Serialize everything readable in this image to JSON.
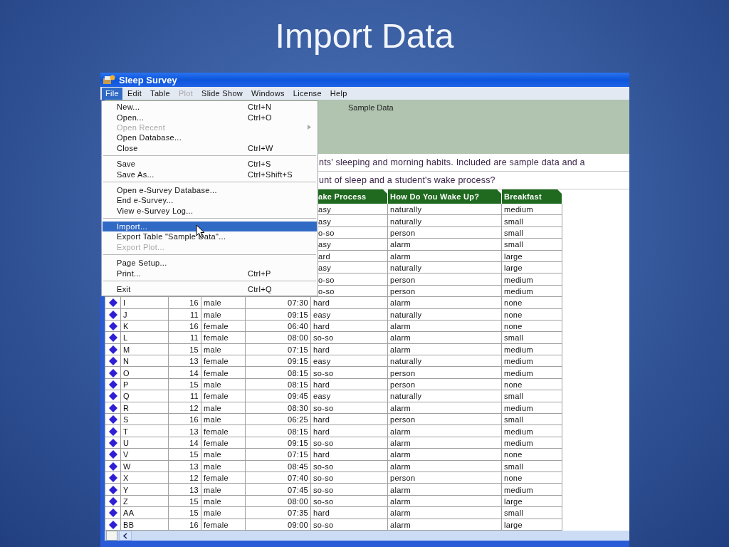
{
  "slide_title": "Import Data",
  "window": {
    "title": "Sleep Survey"
  },
  "menu_bar": [
    {
      "label": "File",
      "selected": true,
      "disabled": false
    },
    {
      "label": "Edit",
      "selected": false,
      "disabled": false
    },
    {
      "label": "Table",
      "selected": false,
      "disabled": false
    },
    {
      "label": "Plot",
      "selected": false,
      "disabled": true
    },
    {
      "label": "Slide Show",
      "selected": false,
      "disabled": false
    },
    {
      "label": "Windows",
      "selected": false,
      "disabled": false
    },
    {
      "label": "License",
      "selected": false,
      "disabled": false
    },
    {
      "label": "Help",
      "selected": false,
      "disabled": false
    }
  ],
  "file_menu": [
    [
      {
        "label": "New...",
        "shortcut": "Ctrl+N",
        "disabled": false,
        "selected": false,
        "submenu": false
      },
      {
        "label": "Open...",
        "shortcut": "Ctrl+O",
        "disabled": false,
        "selected": false,
        "submenu": false
      },
      {
        "label": "Open Recent",
        "disabled": true,
        "selected": false,
        "submenu": true
      },
      {
        "label": "Open Database...",
        "disabled": false,
        "selected": false,
        "submenu": false
      },
      {
        "label": "Close",
        "shortcut": "Ctrl+W",
        "disabled": false,
        "selected": false,
        "submenu": false
      }
    ],
    [
      {
        "label": "Save",
        "shortcut": "Ctrl+S",
        "disabled": false,
        "selected": false,
        "submenu": false
      },
      {
        "label": "Save As...",
        "shortcut": "Ctrl+Shift+S",
        "disabled": false,
        "selected": false,
        "submenu": false
      }
    ],
    [
      {
        "label": "Open e-Survey Database...",
        "disabled": false,
        "selected": false,
        "submenu": false
      },
      {
        "label": "End e-Survey...",
        "disabled": false,
        "selected": false,
        "submenu": false
      },
      {
        "label": "View e-Survey Log...",
        "disabled": false,
        "selected": false,
        "submenu": false
      }
    ],
    [
      {
        "label": "Import...",
        "disabled": false,
        "selected": true,
        "submenu": false
      },
      {
        "label": "Export Table \"Sample Data\"...",
        "disabled": false,
        "selected": false,
        "submenu": false
      },
      {
        "label": "Export Plot...",
        "disabled": true,
        "selected": false,
        "submenu": false
      }
    ],
    [
      {
        "label": "Page Setup...",
        "disabled": false,
        "selected": false,
        "submenu": false
      },
      {
        "label": "Print...",
        "shortcut": "Ctrl+P",
        "disabled": false,
        "selected": false,
        "submenu": false
      }
    ],
    [
      {
        "label": "Exit",
        "shortcut": "Ctrl+Q",
        "disabled": false,
        "selected": false,
        "submenu": false
      }
    ]
  ],
  "table_title": "Sample Data",
  "description_lines": [
    "nts' sleeping and morning habits. Included are sample data and a",
    "unt of sleep and a student's wake process?"
  ],
  "table": {
    "columns": [
      "ake Process",
      "How Do You Wake Up?",
      "Breakfast"
    ],
    "rows": [
      {
        "wake_process": "asy",
        "wake_up": "naturally",
        "breakfast": "medium"
      },
      {
        "wake_process": "asy",
        "wake_up": "naturally",
        "breakfast": "small"
      },
      {
        "wake_process": "o-so",
        "wake_up": "person",
        "breakfast": "small"
      },
      {
        "wake_process": "asy",
        "wake_up": "alarm",
        "breakfast": "small"
      },
      {
        "wake_process": "ard",
        "wake_up": "alarm",
        "breakfast": "large"
      },
      {
        "wake_process": "asy",
        "wake_up": "naturally",
        "breakfast": "large"
      },
      {
        "wake_process": "o-so",
        "wake_up": "person",
        "breakfast": "medium"
      },
      {
        "wake_process": "o-so",
        "wake_up": "person",
        "breakfast": "medium"
      },
      {
        "name": "I",
        "age": "16",
        "gender": "male",
        "time": "07:30",
        "wake_process": "hard",
        "wake_up": "alarm",
        "breakfast": "none"
      },
      {
        "name": "J",
        "age": "11",
        "gender": "male",
        "time": "09:15",
        "wake_process": "easy",
        "wake_up": "naturally",
        "breakfast": "none"
      },
      {
        "name": "K",
        "age": "16",
        "gender": "female",
        "time": "06:40",
        "wake_process": "hard",
        "wake_up": "alarm",
        "breakfast": "none"
      },
      {
        "name": "L",
        "age": "11",
        "gender": "female",
        "time": "08:00",
        "wake_process": "so-so",
        "wake_up": "alarm",
        "breakfast": "small"
      },
      {
        "name": "M",
        "age": "15",
        "gender": "male",
        "time": "07:15",
        "wake_process": "hard",
        "wake_up": "alarm",
        "breakfast": "medium"
      },
      {
        "name": "N",
        "age": "13",
        "gender": "female",
        "time": "09:15",
        "wake_process": "easy",
        "wake_up": "naturally",
        "breakfast": "medium"
      },
      {
        "name": "O",
        "age": "14",
        "gender": "female",
        "time": "08:15",
        "wake_process": "so-so",
        "wake_up": "person",
        "breakfast": "medium"
      },
      {
        "name": "P",
        "age": "15",
        "gender": "male",
        "time": "08:15",
        "wake_process": "hard",
        "wake_up": "person",
        "breakfast": "none"
      },
      {
        "name": "Q",
        "age": "11",
        "gender": "female",
        "time": "09:45",
        "wake_process": "easy",
        "wake_up": "naturally",
        "breakfast": "small"
      },
      {
        "name": "R",
        "age": "12",
        "gender": "male",
        "time": "08:30",
        "wake_process": "so-so",
        "wake_up": "alarm",
        "breakfast": "medium"
      },
      {
        "name": "S",
        "age": "16",
        "gender": "male",
        "time": "06:25",
        "wake_process": "hard",
        "wake_up": "person",
        "breakfast": "small"
      },
      {
        "name": "T",
        "age": "13",
        "gender": "female",
        "time": "08:15",
        "wake_process": "hard",
        "wake_up": "alarm",
        "breakfast": "medium"
      },
      {
        "name": "U",
        "age": "14",
        "gender": "female",
        "time": "09:15",
        "wake_process": "so-so",
        "wake_up": "alarm",
        "breakfast": "medium"
      },
      {
        "name": "V",
        "age": "15",
        "gender": "male",
        "time": "07:15",
        "wake_process": "hard",
        "wake_up": "alarm",
        "breakfast": "none"
      },
      {
        "name": "W",
        "age": "13",
        "gender": "male",
        "time": "08:45",
        "wake_process": "so-so",
        "wake_up": "alarm",
        "breakfast": "small"
      },
      {
        "name": "X",
        "age": "12",
        "gender": "female",
        "time": "07:40",
        "wake_process": "so-so",
        "wake_up": "person",
        "breakfast": "none"
      },
      {
        "name": "Y",
        "age": "13",
        "gender": "male",
        "time": "07:45",
        "wake_process": "so-so",
        "wake_up": "alarm",
        "breakfast": "medium"
      },
      {
        "name": "Z",
        "age": "15",
        "gender": "male",
        "time": "08:00",
        "wake_process": "so-so",
        "wake_up": "alarm",
        "breakfast": "large"
      },
      {
        "name": "AA",
        "age": "15",
        "gender": "male",
        "time": "07:35",
        "wake_process": "hard",
        "wake_up": "alarm",
        "breakfast": "small"
      },
      {
        "name": "BB",
        "age": "16",
        "gender": "female",
        "time": "09:00",
        "wake_process": "so-so",
        "wake_up": "alarm",
        "breakfast": "large"
      }
    ]
  }
}
